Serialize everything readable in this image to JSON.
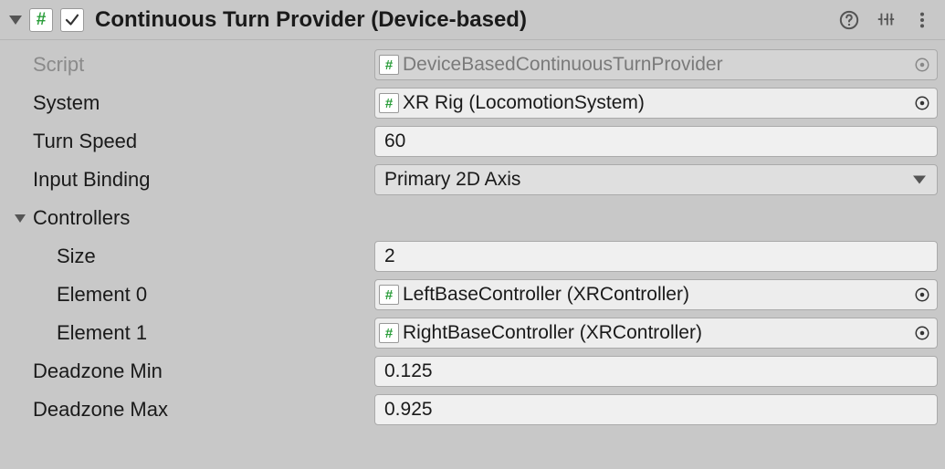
{
  "header": {
    "title": "Continuous Turn Provider (Device-based)",
    "enabled": true
  },
  "fields": {
    "script": {
      "label": "Script",
      "value": "DeviceBasedContinuousTurnProvider"
    },
    "system": {
      "label": "System",
      "value": "XR Rig (LocomotionSystem)"
    },
    "turnSpeed": {
      "label": "Turn Speed",
      "value": "60"
    },
    "inputBinding": {
      "label": "Input Binding",
      "value": "Primary 2D Axis"
    },
    "controllers": {
      "label": "Controllers",
      "sizeLabel": "Size",
      "size": "2",
      "elements": [
        {
          "label": "Element 0",
          "value": "LeftBaseController (XRController)"
        },
        {
          "label": "Element 1",
          "value": "RightBaseController (XRController)"
        }
      ]
    },
    "deadzoneMin": {
      "label": "Deadzone Min",
      "value": "0.125"
    },
    "deadzoneMax": {
      "label": "Deadzone Max",
      "value": "0.925"
    }
  }
}
